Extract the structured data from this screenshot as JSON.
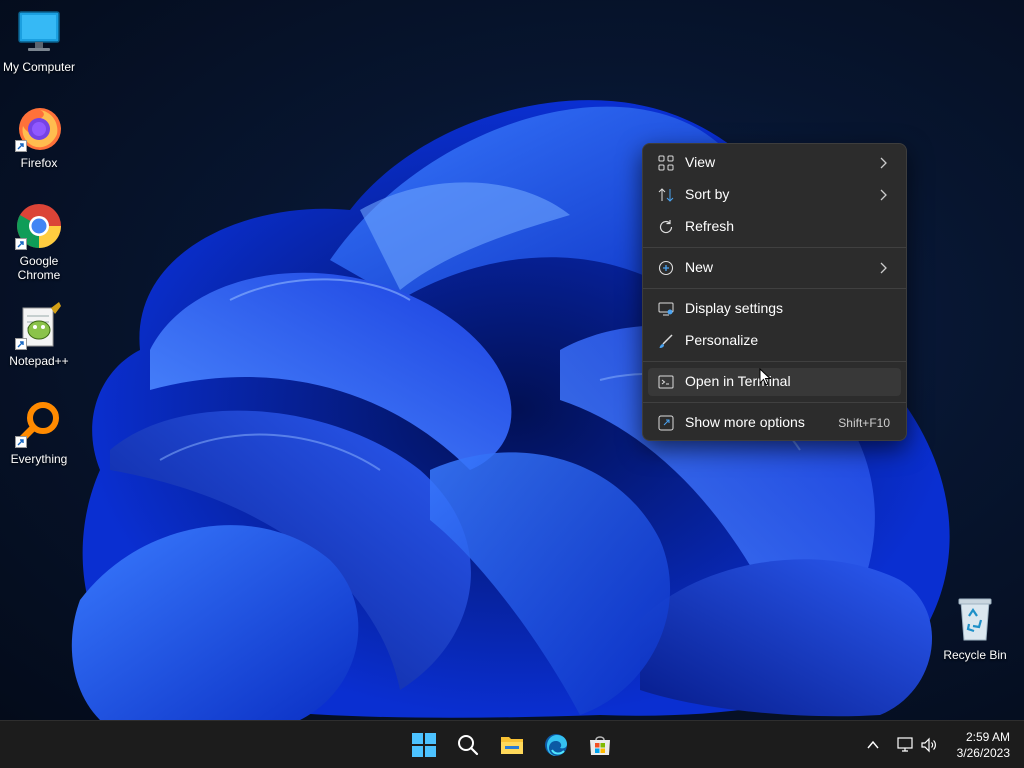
{
  "desktop": {
    "icons": [
      {
        "label": "My Computer"
      },
      {
        "label": "Firefox"
      },
      {
        "label": "Google Chrome"
      },
      {
        "label": "Notepad++"
      },
      {
        "label": "Everything"
      },
      {
        "label": "Recycle Bin"
      }
    ]
  },
  "context_menu": {
    "items": [
      {
        "label": "View",
        "icon": "grid-view-icon",
        "submenu": true
      },
      {
        "label": "Sort by",
        "icon": "sort-icon",
        "submenu": true
      },
      {
        "label": "Refresh",
        "icon": "refresh-icon"
      },
      {
        "label": "New",
        "icon": "plus-circle-icon",
        "submenu": true
      },
      {
        "label": "Display settings",
        "icon": "display-icon"
      },
      {
        "label": "Personalize",
        "icon": "brush-icon"
      },
      {
        "label": "Open in Terminal",
        "icon": "terminal-icon"
      },
      {
        "label": "Show more options",
        "icon": "share-icon",
        "shortcut": "Shift+F10"
      }
    ]
  },
  "taskbar": {
    "apps": [
      "start",
      "search",
      "file-explorer",
      "edge",
      "store"
    ],
    "clock": {
      "time": "2:59 AM",
      "date": "3/26/2023"
    }
  },
  "colors": {
    "menu_bg": "#2c2c2c",
    "taskbar_bg": "#1c1c1c",
    "accent": "#0078d4"
  }
}
